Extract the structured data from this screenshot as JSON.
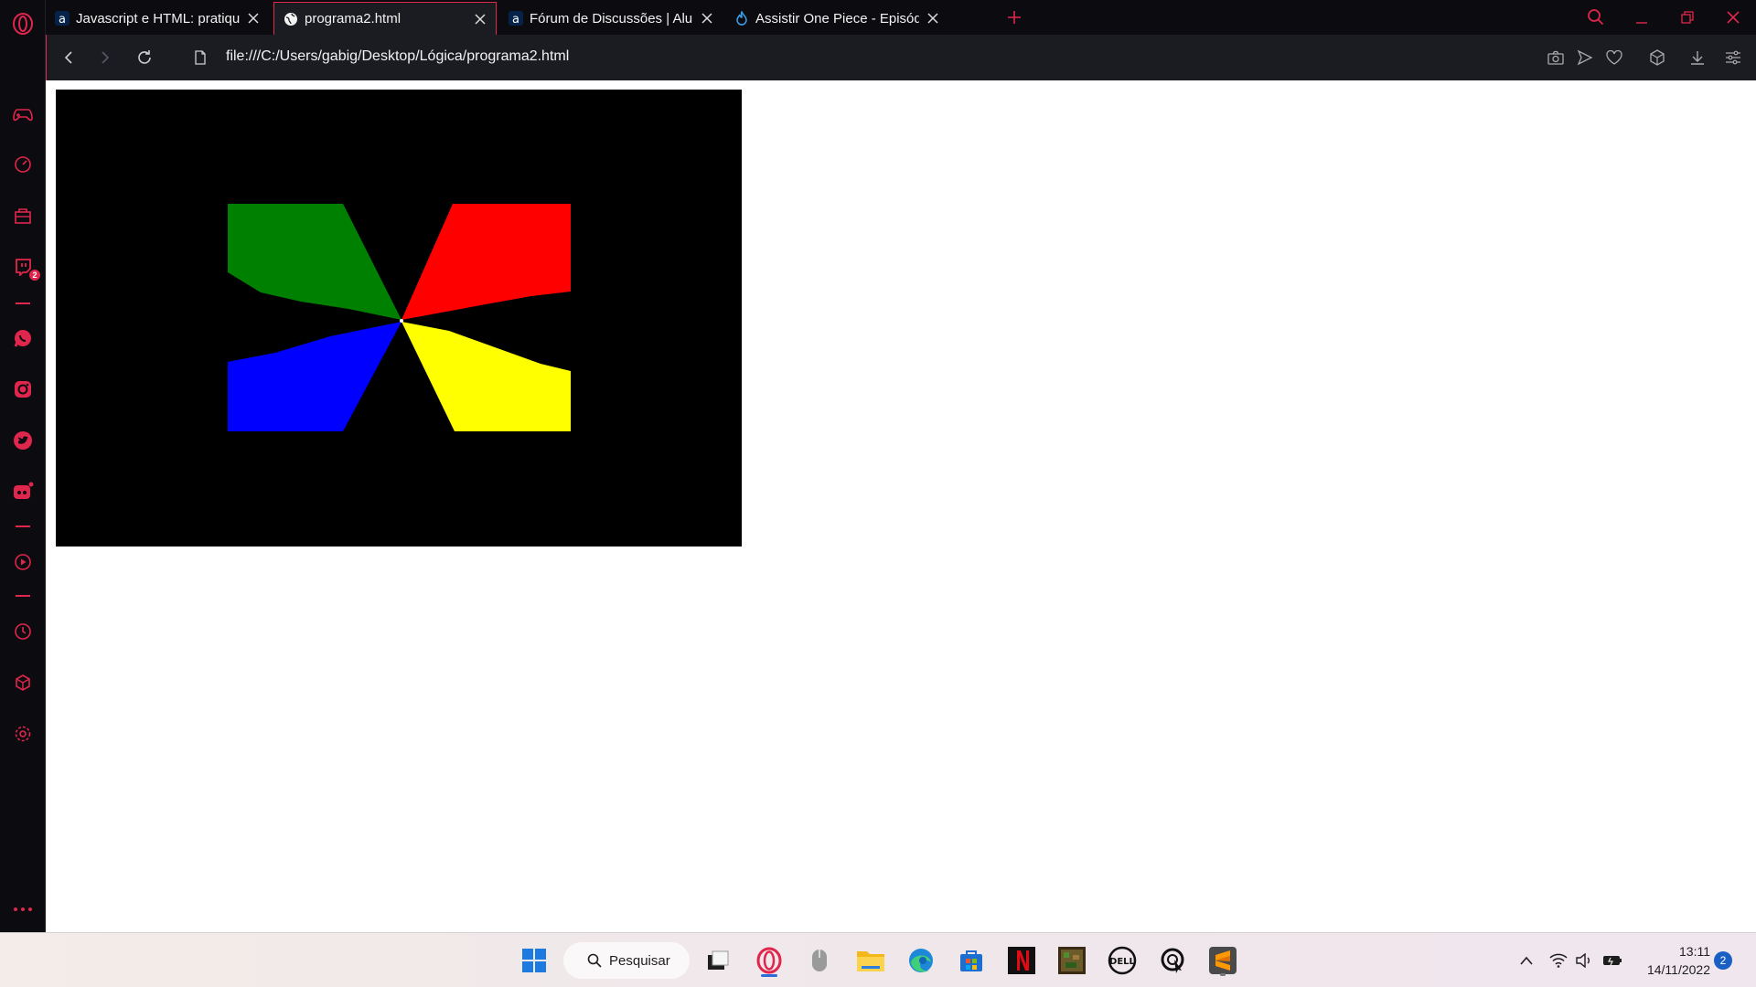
{
  "browser": {
    "name": "Opera GX",
    "accent_color": "#e0264c"
  },
  "tabs": [
    {
      "title": "Javascript e HTML: pratique",
      "favicon": "alura-icon",
      "active": false
    },
    {
      "title": "programa2.html",
      "favicon": "globe-icon",
      "active": true
    },
    {
      "title": "Fórum de Discussões | Alur",
      "favicon": "alura-icon",
      "active": false
    },
    {
      "title": "Assistir One Piece - Episódi",
      "favicon": "flame-icon",
      "active": false
    }
  ],
  "address_bar": {
    "url": "file:///C:/Users/gabig/Desktop/Lógica/programa2.html"
  },
  "sidebar": {
    "items": [
      {
        "icon": "gamepad-icon"
      },
      {
        "icon": "speedometer-icon"
      },
      {
        "icon": "shop-bag-icon"
      },
      {
        "icon": "twitch-icon",
        "badge": "2"
      },
      {
        "icon": "whatsapp-icon"
      },
      {
        "icon": "instagram-icon"
      },
      {
        "icon": "twitter-icon"
      },
      {
        "icon": "discord-icon"
      },
      {
        "icon": "player-icon"
      },
      {
        "icon": "history-icon"
      },
      {
        "icon": "cube-icon"
      },
      {
        "icon": "settings-icon"
      },
      {
        "icon": "more-icon"
      }
    ]
  },
  "canvas": {
    "background": "#000000",
    "shapes": [
      {
        "color": "#008000",
        "name": "green"
      },
      {
        "color": "#ff0000",
        "name": "red"
      },
      {
        "color": "#0000ff",
        "name": "blue"
      },
      {
        "color": "#ffff00",
        "name": "yellow"
      }
    ]
  },
  "taskbar": {
    "search_label": "Pesquisar",
    "apps": [
      "start-icon",
      "task-view-icon",
      "opera-gx-icon",
      "mouse-icon",
      "file-explorer-icon",
      "edge-icon",
      "store-icon",
      "netflix-icon",
      "minecraft-icon",
      "dell-icon",
      "cursor-app-icon",
      "sublime-text-icon"
    ],
    "time": "13:11",
    "date": "14/11/2022",
    "notification_count": "2"
  }
}
